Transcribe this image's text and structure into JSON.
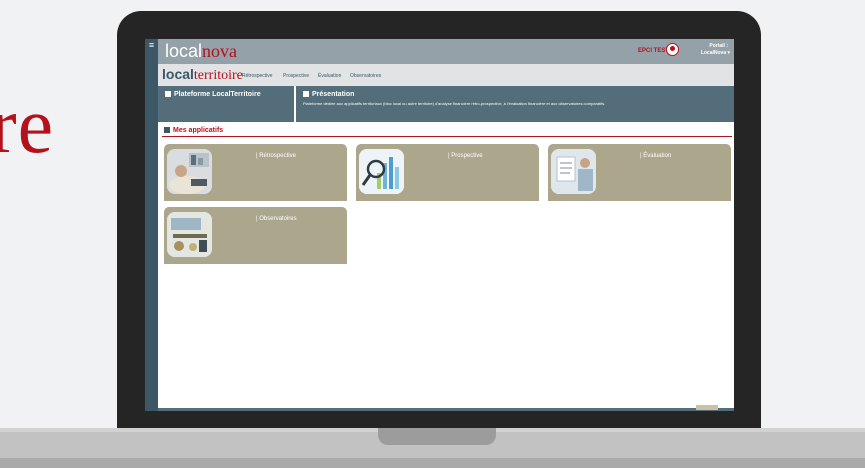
{
  "background_word": "re",
  "topbar": {
    "logo_part1": "local",
    "logo_part2": "nova",
    "user_name": "EPCI TEST",
    "portal_label": "Portail :",
    "portal_value": "LocalNova ▾"
  },
  "subnav": {
    "logo_part1": "local",
    "logo_part2": "territoire",
    "links": [
      "Rétrospective",
      "Prospective",
      "Évaluation",
      "Observatoires"
    ]
  },
  "panels": {
    "left_title": "Plateforme LocalTerritoire",
    "right_title": "Présentation",
    "right_desc": "Plateforme dédiée aux applicatifs territoriaux (bloc local ou autre territoire) d'analyse financière rétro-prospective, à l'évaluation financière et aux observatoires comparatifs."
  },
  "section": {
    "title": "Mes applicatifs"
  },
  "apps": [
    {
      "label": "| Rétrospective"
    },
    {
      "label": "| Prospective"
    },
    {
      "label": "| Évaluation"
    },
    {
      "label": "| Observatoires"
    }
  ],
  "colors": {
    "brand_red": "#b4111c",
    "dark_blue": "#3c5765",
    "panel_blue": "#536d7a",
    "card_khaki": "#aca68c"
  }
}
